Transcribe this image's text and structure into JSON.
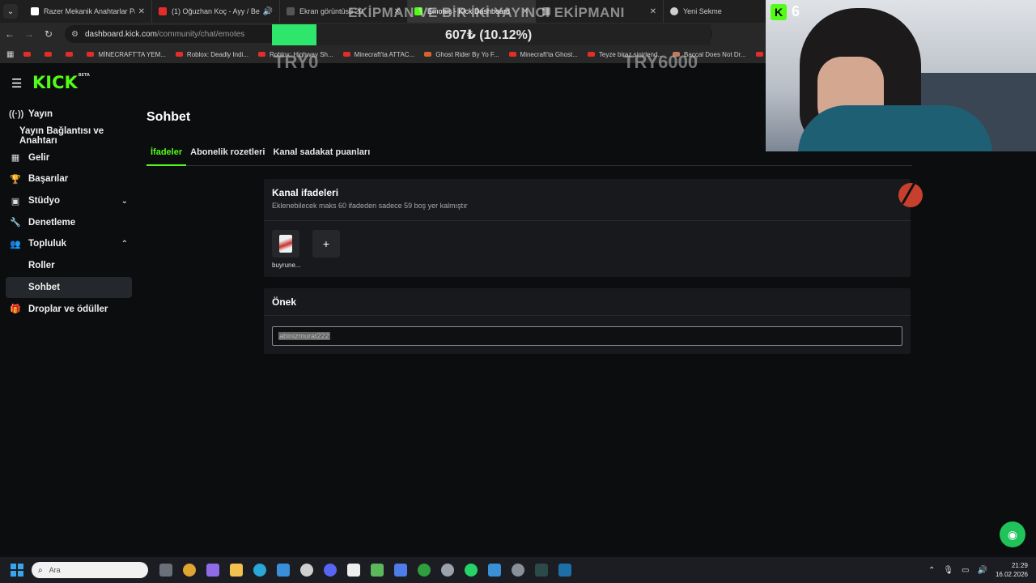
{
  "browser": {
    "tabs": [
      {
        "label": "Razer Mekanik Anahtarlar Paket",
        "color": "#ffffff",
        "active": false
      },
      {
        "label": "(1) Oğuzhan Koç - Ayy / Be",
        "color": "#e52d27",
        "active": false
      },
      {
        "label": "Ekran görüntüsü 20",
        "color": "#555555",
        "active": false
      },
      {
        "label": "Emotes - Kick Dashboard",
        "color": "#53fc18",
        "active": true
      },
      {
        "label": "",
        "color": "#888888",
        "active": false
      },
      {
        "label": "Yeni Sekme",
        "color": "#cfcfcf",
        "active": false
      }
    ],
    "url_host": "dashboard.kick.com",
    "url_path": "/community/chat/emotes",
    "bookmarks": [
      "",
      "",
      "",
      "MİNECRAFT'TA YEM...",
      "Roblox: Deadly Indi...",
      "Roblox: Highway Sh...",
      "Minecraft'ta ATTAC...",
      "Ghost Rider By Yo F...",
      "Minecraft'ta Ghost...",
      "Teyze biraz sinirlend...",
      "Baççal Does Not Dr...",
      "Ro"
    ]
  },
  "overlay": {
    "title": "EKİPMAN VE BİR İKİ YAYINCI EKİPMANI",
    "amount": "607₺ (10.12%)",
    "progress": 0.1012,
    "min": "TRY0",
    "max": "TRY6000",
    "viewer_count": "6"
  },
  "app": {
    "logo": "KICK",
    "logo_tag": "BETA"
  },
  "sidebar": {
    "items": [
      {
        "label": "Yayın",
        "icon": "broadcast-icon"
      },
      {
        "label": "Yayın Bağlantısı ve Anahtarı",
        "icon": ""
      },
      {
        "label": "Gelir",
        "icon": "chart-icon"
      },
      {
        "label": "Başarılar",
        "icon": "trophy-icon"
      },
      {
        "label": "Stüdyo",
        "icon": "studio-icon"
      },
      {
        "label": "Denetleme",
        "icon": "wrench-icon"
      },
      {
        "label": "Topluluk",
        "icon": "community-icon"
      },
      {
        "label": "Roller",
        "icon": ""
      },
      {
        "label": "Sohbet",
        "icon": ""
      },
      {
        "label": "Droplar ve ödüller",
        "icon": "gift-icon"
      }
    ]
  },
  "main": {
    "title": "Sohbet",
    "tabs": [
      "İfadeler",
      "Abonelik rozetleri",
      "Kanal sadakat puanları"
    ],
    "emotes_card": {
      "title": "Kanal ifadeleri",
      "subtitle": "Eklenebilecek maks 60 ifadeden sadece 59 boş yer kalmıştır",
      "emote_label": "buyrune..."
    },
    "prefix_card": {
      "title": "Önek",
      "value": "abinizmurat222"
    }
  },
  "taskbar": {
    "search_placeholder": "Ara",
    "time": "21:29",
    "date": "16.02.2026"
  }
}
